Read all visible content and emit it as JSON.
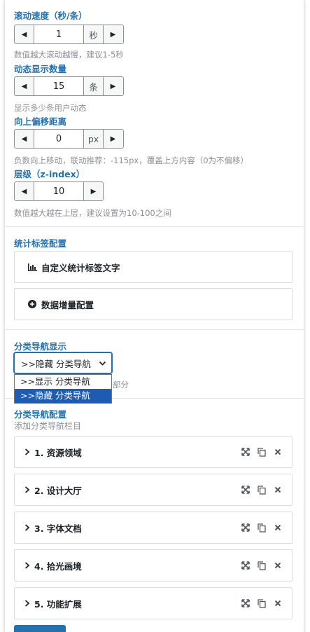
{
  "scroll_speed": {
    "label": "滚动速度（秒/条）",
    "value": "1",
    "unit": "秒",
    "help": "数值越大滚动越慢，建议1-5秒"
  },
  "display_count": {
    "label": "动态显示数量",
    "value": "15",
    "unit": "条",
    "help": "显示多少条用户动态"
  },
  "offset_up": {
    "label": "向上偏移距离",
    "value": "0",
    "unit": "px",
    "help": "负数向上移动，联动推荐：-115px，覆盖上方内容（0为不偏移）"
  },
  "z_index": {
    "label": "层级（z-index）",
    "value": "10",
    "help": "数值越大越在上层，建议设置为10-100之间"
  },
  "stats_tag": {
    "section_title": "统计标签配置",
    "custom_text_label": "自定义统计标签文字",
    "growth_label": "数据增量配置"
  },
  "category_nav": {
    "section_title": "分类导航显示",
    "selected": ">>隐藏 分类导航",
    "options": [
      ">>显示 分类导航",
      ">>隐藏 分类导航"
    ],
    "help_partial": "部分"
  },
  "nav_config": {
    "section_title": "分类导航配置",
    "subtitle": "添加分类导航栏目",
    "items": [
      {
        "label": "1. 资源领域"
      },
      {
        "label": "2. 设计大厅"
      },
      {
        "label": "3. 字体文档"
      },
      {
        "label": "4. 拾光画境"
      },
      {
        "label": "5. 功能扩展"
      }
    ]
  },
  "icons": {
    "decrement": "caret-left-icon",
    "increment": "caret-right-icon",
    "chart": "bar-chart-icon",
    "plus": "plus-circle-icon",
    "expand": "expand-icon",
    "copy": "copy-icon",
    "delete": "close-icon"
  },
  "accent_color": "#2271b1",
  "selected_option_color": "#1e5cb3"
}
